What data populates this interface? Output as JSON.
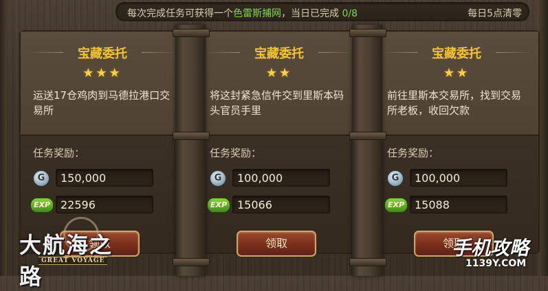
{
  "top_bar": {
    "prefix": "每次完成任务可获得一个",
    "item": "色雷斯捕网",
    "middle": "，当日已完成",
    "progress": "0/8",
    "reset_note": "每日5点清零"
  },
  "cards": [
    {
      "title": "宝藏委托",
      "stars": "★★★",
      "star_count": 3,
      "description": "运送17仓鸡肉到马德拉港口交易所",
      "reward_label": "任务奖励：",
      "coin_icon": "G",
      "coins": "150,000",
      "exp_icon": "EXP",
      "exp": "22596",
      "button": "领取"
    },
    {
      "title": "宝藏委托",
      "stars": "★★",
      "star_count": 2,
      "description": "将这封紧急信件交到里斯本码头官员手里",
      "reward_label": "任务奖励：",
      "coin_icon": "G",
      "coins": "100,000",
      "exp_icon": "EXP",
      "exp": "15066",
      "button": "领取"
    },
    {
      "title": "宝藏委托",
      "stars": "★★",
      "star_count": 2,
      "description": "前往里斯本交易所，找到交易所老板，收回欠款",
      "reward_label": "任务奖励：",
      "coin_icon": "G",
      "coins": "100,000",
      "exp_icon": "EXP",
      "exp": "15088",
      "button": "领取"
    }
  ],
  "game_logo": {
    "title": "大航海之路",
    "subtitle": "GREAT VOYAGE"
  },
  "watermark": {
    "main": "手机攻略",
    "sub": "1139Y.COM"
  },
  "colors": {
    "accent_gold": "#f3c431",
    "progress_green": "#7fd84a",
    "button_red": "#7a2f1b"
  }
}
